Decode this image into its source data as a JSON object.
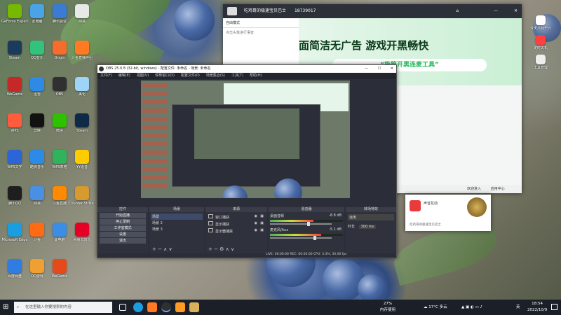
{
  "desktop_icons": [
    {
      "label": "GeForce Experience",
      "color": "#76b900"
    },
    {
      "label": "此电脑",
      "color": "#4aa3e8"
    },
    {
      "label": "腾讯会议",
      "color": "#3a7bd5"
    },
    {
      "label": "网易",
      "color": "#e8e8e8"
    },
    {
      "label": "Steam",
      "color": "#1b3a5c"
    },
    {
      "label": "QQ音乐",
      "color": "#31c27c"
    },
    {
      "label": "Origin",
      "color": "#f56c2d"
    },
    {
      "label": "斗鱼直播伴侣",
      "color": "#ff7a22"
    },
    {
      "label": "WeGame",
      "color": "#c62828"
    },
    {
      "label": "迅雷",
      "color": "#2f8ae6"
    },
    {
      "label": "OBS",
      "color": "#303030"
    },
    {
      "label": "美化",
      "color": "#9ed4f7"
    },
    {
      "label": "WPS",
      "color": "#ff5b3d"
    },
    {
      "label": "剪映",
      "color": "#111111"
    },
    {
      "label": "微信",
      "color": "#2dc100"
    },
    {
      "label": "Steam",
      "color": "#0f2a47"
    },
    {
      "label": "WPS文字",
      "color": "#2b65d9"
    },
    {
      "label": "酷狗音乐",
      "color": "#2b8be6"
    },
    {
      "label": "WPS表格",
      "color": "#2fb35b"
    },
    {
      "label": "YY语音",
      "color": "#ffcc00"
    },
    {
      "label": "腾讯QQ",
      "color": "#1e1e1e"
    },
    {
      "label": "网易",
      "color": "#4a90e2"
    },
    {
      "label": "斗鱼直播",
      "color": "#ff8a00"
    },
    {
      "label": "Counter-Strike Global",
      "color": "#d69a2e"
    },
    {
      "label": "Microsoft Edge",
      "color": "#1b9de2"
    },
    {
      "label": "斗鱼",
      "color": "#ff6a13"
    },
    {
      "label": "此电脑",
      "color": "#3a8ee6"
    },
    {
      "label": "网易云音乐",
      "color": "#e60026"
    },
    {
      "label": "百度网盘",
      "color": "#2f7de1"
    },
    {
      "label": "QQ游戏",
      "color": "#f0a030"
    },
    {
      "label": "WeGame",
      "color": "#e64a19"
    }
  ],
  "obs": {
    "title": "OBS 25.0.8 (32-bit, windows) - 配置文件: 未命名 - 场景: 未命名",
    "menu": [
      "文件(F)",
      "编辑(E)",
      "视图(V)",
      "停靠窗口(D)",
      "配置文件(P)",
      "场景集合(S)",
      "工具(T)",
      "帮助(H)"
    ],
    "dock_titles": [
      "控件",
      "场景",
      "来源",
      "混音器",
      "转场特效"
    ],
    "controls": [
      "开始直播",
      "停止录制",
      "工作室模式",
      "设置",
      "退出"
    ],
    "scenes": [
      "场景",
      "场景 2",
      "场景 3"
    ],
    "sources": [
      "窗口捕获",
      "显示捕获",
      "显示器捕获"
    ],
    "mixer": [
      {
        "name": "桌面音频",
        "db": "-8.8 dB",
        "level": 0.6
      },
      {
        "name": "麦克风/Aux",
        "db": "-5.1 dB",
        "level": 0.7
      }
    ],
    "transition": {
      "type": "淡出",
      "duration_label": "时长",
      "duration": "300 ms"
    },
    "status": "LIVE: 00:00:00   REC: 00:00:00   CPU: 3.3%, 30.00 fps"
  },
  "chat": {
    "title": "吃鸡哥的极速宝贝巴士",
    "room_id": "18739017",
    "banner_line1": "面简洁无广告  游戏开黑畅快",
    "banner_line2": "“极简开黑连麦工具”",
    "mode": "自由模式",
    "sidebar_label": "点击头像进行语音",
    "bottom_left": "欢迎进入",
    "bottom_right": "应用中心",
    "card_title": "声音互动",
    "card_sub": "吃鸡哥的极速宝贝巴士"
  },
  "right_icons": [
    {
      "label": "今天八月十六",
      "color": "#ffffff"
    },
    {
      "label": "定时关机",
      "color": "#ff4040"
    },
    {
      "label": "工具管理",
      "color": "#eeeeee"
    }
  ],
  "taskbar": {
    "search_placeholder": "在这里输入你要搜索的内容",
    "cpu": "27%",
    "cpu_label": "内存使用",
    "weather": "17°C 多云",
    "time": "18:54",
    "date": "2022/10/9",
    "lang": "英"
  }
}
